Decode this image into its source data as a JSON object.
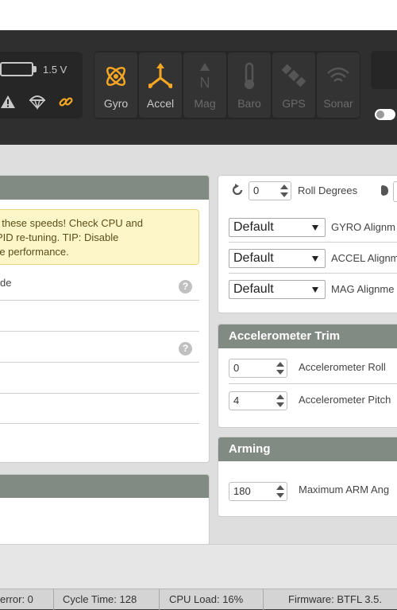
{
  "header": {
    "battery_voltage": "1.5 V",
    "sensors": [
      {
        "label": "Gyro",
        "active": true,
        "icon": "gyro-icon"
      },
      {
        "label": "Accel",
        "active": true,
        "icon": "accel-icon"
      },
      {
        "label": "Mag",
        "active": false,
        "icon": "mag-icon"
      },
      {
        "label": "Baro",
        "active": false,
        "icon": "baro-icon"
      },
      {
        "label": "GPS",
        "active": false,
        "icon": "gps-icon"
      },
      {
        "label": "Sonar",
        "active": false,
        "icon": "sonar-icon"
      }
    ],
    "mag_letter": "N",
    "status_icons": [
      "warning-icon",
      "parachute-icon",
      "link-icon"
    ]
  },
  "left": {
    "warning_lines": [
      "t these speeds! Check CPU and",
      " PID re-tuning. TIP: Disable",
      "re performance."
    ],
    "row1_label": "de"
  },
  "board_alignment": {
    "roll_value": "0",
    "roll_label": "Roll Degrees"
  },
  "sensor_alignment": [
    {
      "value": "Default",
      "label": "GYRO Alignm"
    },
    {
      "value": "Default",
      "label": "ACCEL Alignm"
    },
    {
      "value": "Default",
      "label": "MAG Alignme"
    }
  ],
  "accel_trim": {
    "title": "Accelerometer Trim",
    "roll_value": "0",
    "roll_label": "Accelerometer Roll",
    "pitch_value": "4",
    "pitch_label": "Accelerometer Pitch"
  },
  "arming": {
    "title": "Arming",
    "angle_value": "180",
    "angle_label": "Maximum ARM Ang"
  },
  "status_bar": {
    "error": "error: 0",
    "cycle_time": "Cycle Time: 128",
    "cpu_load": "CPU Load: 16%",
    "firmware": "Firmware: BTFL 3.5."
  },
  "colors": {
    "accent": "#f5a623",
    "header_bg": "#2f2f2f",
    "panel_header": "#828a84",
    "warning_bg": "#fdf6c8"
  }
}
